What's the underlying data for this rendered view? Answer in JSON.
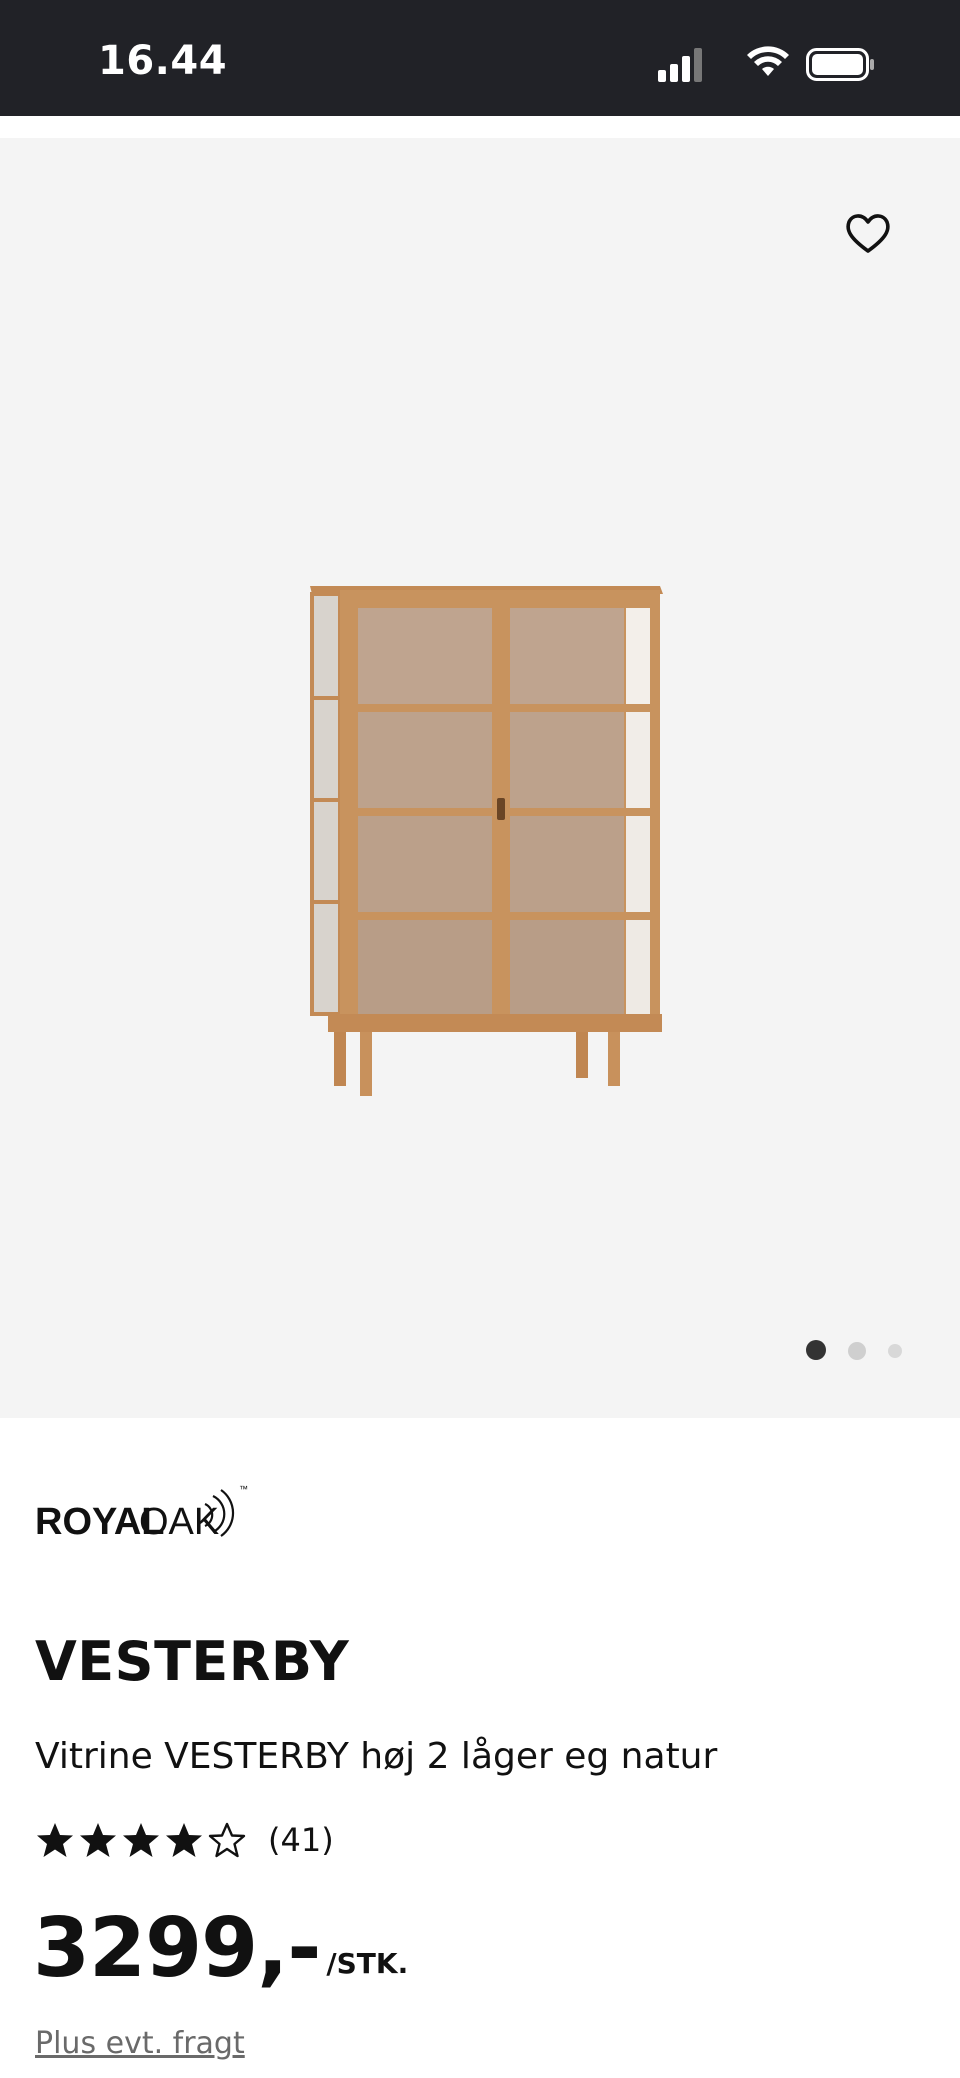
{
  "status_bar": {
    "time": "16.44",
    "icons": [
      "signal-icon",
      "wifi-icon",
      "battery-icon"
    ]
  },
  "gallery": {
    "favorite_icon": "heart-outline-icon",
    "image_subject": "product-photo",
    "slide_count": 3,
    "active_slide": 1
  },
  "brand": {
    "logo_text_bold": "ROYAL",
    "logo_text_light": "OAK",
    "logo_tm": "™"
  },
  "product": {
    "name": "VESTERBY",
    "description": "Vitrine VESTERBY høj 2 låger eg natur",
    "rating_stars_filled": 4,
    "rating_stars_total": 5,
    "rating_count": "(41)",
    "price": "3299,-",
    "price_unit": "/STK.",
    "shipping_note": "Plus evt. fragt"
  },
  "colors": {
    "status_bar_bg": "#212227",
    "gallery_bg": "#f4f4f4",
    "wood": "#c8915c"
  }
}
